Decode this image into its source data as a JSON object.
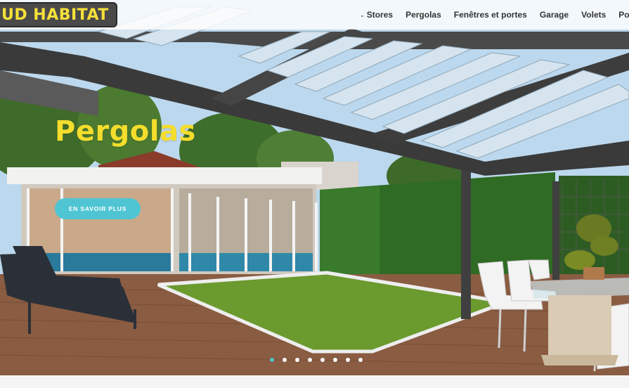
{
  "logo": {
    "text": "UD HABITAT"
  },
  "nav": {
    "items": [
      {
        "label": "Stores",
        "has_dropdown": true
      },
      {
        "label": "Pergolas",
        "has_dropdown": false
      },
      {
        "label": "Fenêtres et portes",
        "has_dropdown": false
      },
      {
        "label": "Garage",
        "has_dropdown": false
      },
      {
        "label": "Volets",
        "has_dropdown": false
      },
      {
        "label": "Portails",
        "has_dropdown": false
      }
    ]
  },
  "hero": {
    "title": "Pergolas",
    "cta_label": "EN SAVOIR PLUS",
    "slides": {
      "count": 8,
      "active_index": 0
    }
  },
  "colors": {
    "accent": "#4fc5d3",
    "title_yellow": "#f4dd2c",
    "logo_yellow": "#f6e03a",
    "logo_bg": "#4a4a4a"
  }
}
